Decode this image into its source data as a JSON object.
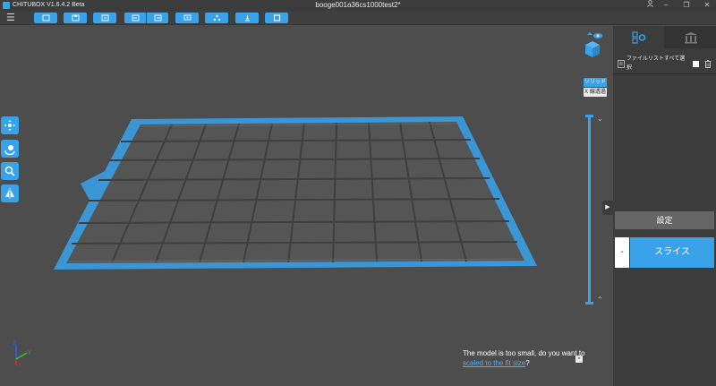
{
  "window": {
    "app_title": "CHITUBOX V1.6.4.2 Beta",
    "document_title": "booge001a36cs1000test2*",
    "controls": {
      "user": "user-icon",
      "minimize": "–",
      "restore": "❐",
      "close": "✕"
    }
  },
  "toolbar": {
    "menu_icon": "☰",
    "buttons": [
      "open-file-icon",
      "save-file-icon",
      "import-icon",
      "undo-icon",
      "redo-icon",
      "screen-icon",
      "network-icon",
      "support-icon",
      "slice-view-icon"
    ]
  },
  "viewport": {
    "view_modes": {
      "solid": "ソリッド",
      "xray": "X 線透過"
    },
    "slider_up": "⌄",
    "slider_down": "⌃",
    "axes": {
      "x": "X",
      "y": "Y",
      "z": "Z"
    },
    "notice": {
      "text": "The model is too small, do you want to",
      "link": "scaled to the fit size",
      "suffix": "?",
      "close": "×"
    }
  },
  "panel": {
    "tabs": [
      "settings-tab",
      "model-library-tab"
    ],
    "select_all_label": "ファイルリストすべて選択",
    "expand": "▶",
    "settings_button": "設定",
    "slice_minus": "-",
    "slice_button": "スライス"
  },
  "colors": {
    "accent": "#3aa2e9",
    "background": "#4d4d4d",
    "panel": "#3c3c3c"
  }
}
